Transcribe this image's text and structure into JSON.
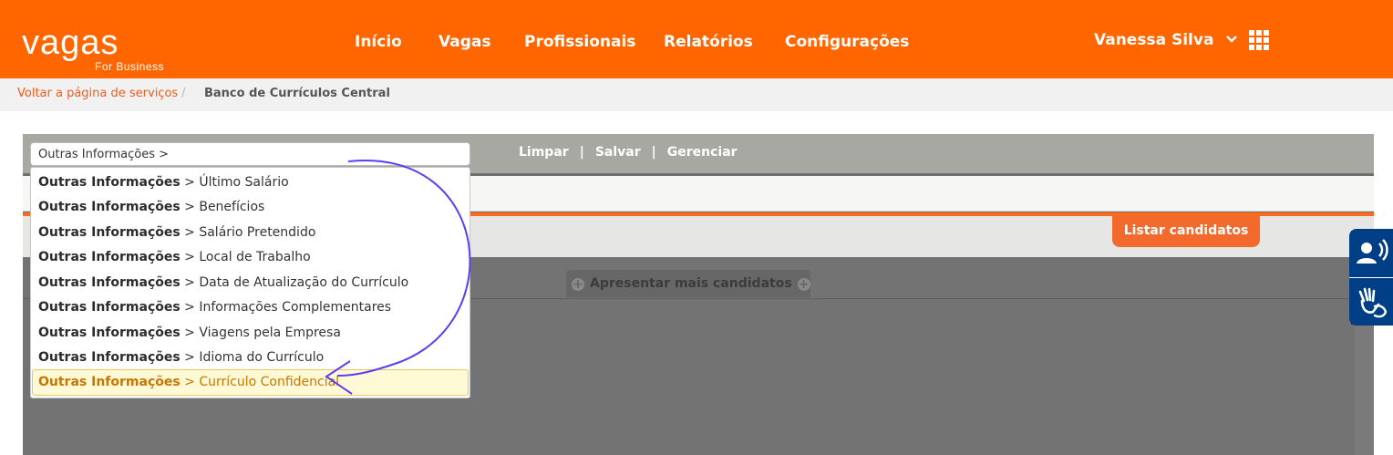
{
  "brand": {
    "logo_text": "vagas",
    "logo_sub": "For Business"
  },
  "nav": {
    "items": [
      {
        "label": "Início"
      },
      {
        "label": "Vagas"
      },
      {
        "label": "Profissionais"
      },
      {
        "label": "Relatórios"
      },
      {
        "label": "Configurações"
      }
    ],
    "user_name": "Vanessa Silva",
    "user_icon": "chevron-down-icon",
    "apps_icon": "grid-icon"
  },
  "breadcrumb": {
    "back_label": "Voltar a página de serviços",
    "separator": "/",
    "current": "Banco de Currículos Central"
  },
  "search": {
    "value": "Outras Informações >",
    "options": [
      {
        "prefix": "Outras Informações",
        "suffix": " > Último Salário"
      },
      {
        "prefix": "Outras Informações",
        "suffix": " > Benefícios"
      },
      {
        "prefix": "Outras Informações",
        "suffix": " > Salário Pretendido"
      },
      {
        "prefix": "Outras Informações",
        "suffix": " > Local de Trabalho"
      },
      {
        "prefix": "Outras Informações",
        "suffix": " > Data de Atualização do Currículo"
      },
      {
        "prefix": "Outras Informações",
        "suffix": " > Informações Complementares"
      },
      {
        "prefix": "Outras Informações",
        "suffix": " > Viagens pela Empresa"
      },
      {
        "prefix": "Outras Informações",
        "suffix": " > Idioma do Currículo"
      },
      {
        "prefix": "Outras Informações",
        "suffix": " > Currículo Confidencial"
      }
    ],
    "highlighted_index": 8
  },
  "toolbar": {
    "clear_label": "Limpar",
    "save_label": "Salvar",
    "manage_label": "Gerenciar",
    "separator": "|"
  },
  "results": {
    "list_button": "Listar candidatos",
    "more_button": "Apresentar mais candidatos"
  },
  "accessibility": {
    "audio_icon": "audio-reader-icon",
    "sign_icon": "sign-language-icon"
  },
  "colors": {
    "brand_orange": "#ff6600",
    "annotation": "#5b3df5",
    "highlight_text": "#c97600",
    "accessibility_blue": "#003f86"
  }
}
